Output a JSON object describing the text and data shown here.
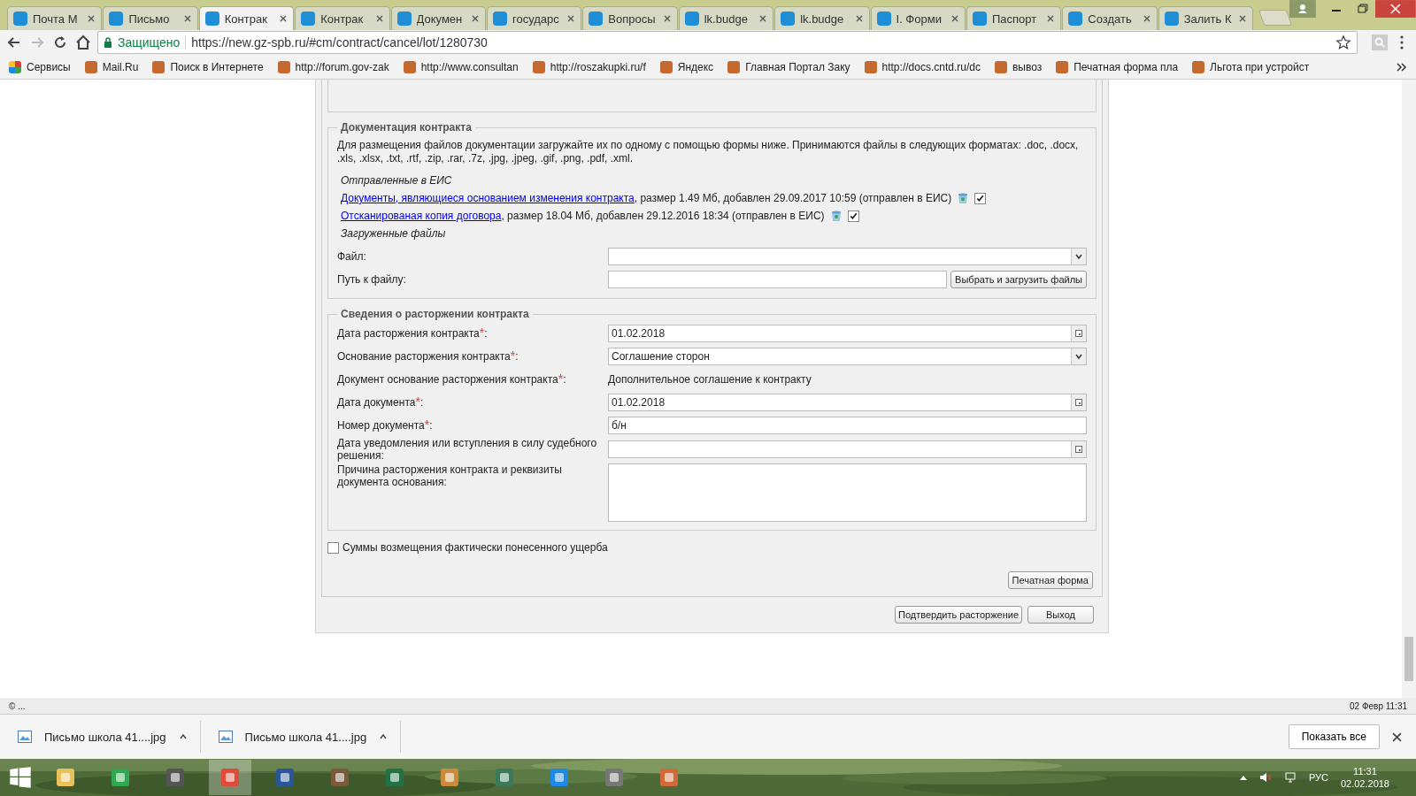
{
  "tabs": [
    {
      "label": "Почта М",
      "selected": false
    },
    {
      "label": "Письмо",
      "selected": false
    },
    {
      "label": "Контрак",
      "selected": true
    },
    {
      "label": "Контрак",
      "selected": false
    },
    {
      "label": "Докумен",
      "selected": false
    },
    {
      "label": "государс",
      "selected": false
    },
    {
      "label": "Вопросы",
      "selected": false
    },
    {
      "label": "lk.budge",
      "selected": false
    },
    {
      "label": "lk.budge",
      "selected": false
    },
    {
      "label": "I. Форми",
      "selected": false
    },
    {
      "label": "Паспорт",
      "selected": false
    },
    {
      "label": "Создать",
      "selected": false
    },
    {
      "label": "Залить К",
      "selected": false
    }
  ],
  "address": {
    "secure_label": "Защищено",
    "url": "https://new.gz-spb.ru/#cm/contract/cancel/lot/1280730"
  },
  "bookmarks": [
    "Сервисы",
    "Mail.Ru",
    "Поиск в Интернете",
    "http://forum.gov-zak",
    "http://www.consultan",
    "http://roszakupki.ru/f",
    "Яндекс",
    "Главная Портал Заку",
    "http://docs.cntd.ru/dc",
    "вывоз",
    "Печатная форма пла",
    "Льгота при устройст"
  ],
  "documentation": {
    "legend": "Документация контракта",
    "intro": "Для размещения файлов документации загружайте их по одному с помощью формы ниже. Принимаются файлы в следующих форматах: .doc, .docx, .xls, .xlsx, .txt, .rtf, .zip, .rar, .7z, .jpg, .jpeg, .gif, .png, .pdf, .xml.",
    "sent_heading": "Отправленные в ЕИС",
    "files": [
      {
        "link": "Документы, являющиеся основанием изменения контракта",
        "info": ", размер 1.49 Мб, добавлен 29.09.2017 10:59 (отправлен в ЕИС)",
        "checked": true
      },
      {
        "link": "Отсканированая копия договора",
        "info": ", размер 18.04 Мб, добавлен 29.12.2016 18:34 (отправлен в ЕИС)",
        "checked": true
      }
    ],
    "uploaded_heading": "Загруженные файлы",
    "file_label": "Файл:",
    "path_label": "Путь к файлу:",
    "upload_button": "Выбрать и загрузить файлы"
  },
  "cancellation": {
    "legend": "Сведения о расторжении контракта",
    "fields": [
      {
        "kind": "date",
        "label": "Дата расторжения контракта",
        "required_mark": "*",
        "label_end": ":",
        "value": "01.02.2018"
      },
      {
        "kind": "select",
        "label": "Основание расторжения контракта",
        "required_mark": "*",
        "label_end": ":",
        "value": "Соглашение сторон"
      },
      {
        "kind": "static",
        "label": "Документ основание расторжения контракта",
        "required_mark": "*",
        "label_end": ":",
        "value": "Дополнительное соглашение к контракту"
      },
      {
        "kind": "date",
        "label": "Дата документа",
        "required_mark": "*",
        "label_end": ":",
        "value": "01.02.2018"
      },
      {
        "kind": "text",
        "label": "Номер документа",
        "required_mark": "*",
        "label_end": ":",
        "value": "б/н"
      },
      {
        "kind": "date",
        "label": "Дата уведомления или вступления в силу судебного решения:"
      },
      {
        "kind": "textarea",
        "label": "Причина расторжения контракта и реквизиты документа основания:"
      }
    ]
  },
  "damages": {
    "label": "Суммы возмещения фактически понесенного ущерба",
    "checked": false
  },
  "print_button": "Печатная форма",
  "actions": [
    "Подтвердить расторжение",
    "Выход"
  ],
  "footer": {
    "left": "© ...",
    "right": "02 Февр 11:31"
  },
  "downloads": [
    {
      "name": "Письмо школа 41....jpg"
    },
    {
      "name": "Письмо школа 41....jpg"
    }
  ],
  "show_all": "Показать все",
  "taskbar": {
    "language": "РУС",
    "time": "11:31",
    "date": "02.02.2018"
  }
}
